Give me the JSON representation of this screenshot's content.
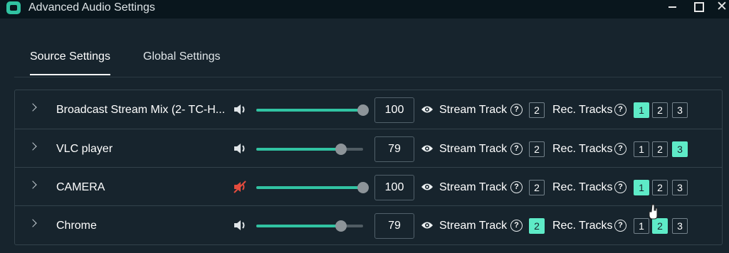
{
  "window": {
    "title": "Advanced Audio Settings",
    "close_glyph": "✕"
  },
  "tabs": [
    {
      "label": "Source Settings",
      "active": true
    },
    {
      "label": "Global Settings",
      "active": false
    }
  ],
  "labels": {
    "stream_track": "Stream Track",
    "rec_tracks": "Rec. Tracks",
    "help_glyph": "?"
  },
  "sources": [
    {
      "name": "Broadcast Stream Mix (2- TC-H...",
      "volume": "100",
      "volume_level": 1.0,
      "muted": false,
      "stream_track": "2",
      "stream_track_on": false,
      "rec_tracks": [
        {
          "label": "1",
          "on": true
        },
        {
          "label": "2",
          "on": false
        },
        {
          "label": "3",
          "on": false
        }
      ]
    },
    {
      "name": "VLC player",
      "volume": "79",
      "volume_level": 0.79,
      "muted": false,
      "stream_track": "2",
      "stream_track_on": false,
      "rec_tracks": [
        {
          "label": "1",
          "on": false
        },
        {
          "label": "2",
          "on": false
        },
        {
          "label": "3",
          "on": true
        }
      ]
    },
    {
      "name": "CAMERA",
      "volume": "100",
      "volume_level": 1.0,
      "muted": true,
      "stream_track": "2",
      "stream_track_on": false,
      "rec_tracks": [
        {
          "label": "1",
          "on": true
        },
        {
          "label": "2",
          "on": false
        },
        {
          "label": "3",
          "on": false
        }
      ]
    },
    {
      "name": "Chrome",
      "volume": "79",
      "volume_level": 0.79,
      "muted": false,
      "stream_track": "2",
      "stream_track_on": true,
      "rec_tracks": [
        {
          "label": "1",
          "on": false
        },
        {
          "label": "2",
          "on": true
        },
        {
          "label": "3",
          "on": false
        }
      ]
    }
  ],
  "colors": {
    "accent": "#5eebc7",
    "slider_fill": "#31c3a2",
    "muted_icon": "#e44b3d",
    "background": "#17242d"
  }
}
